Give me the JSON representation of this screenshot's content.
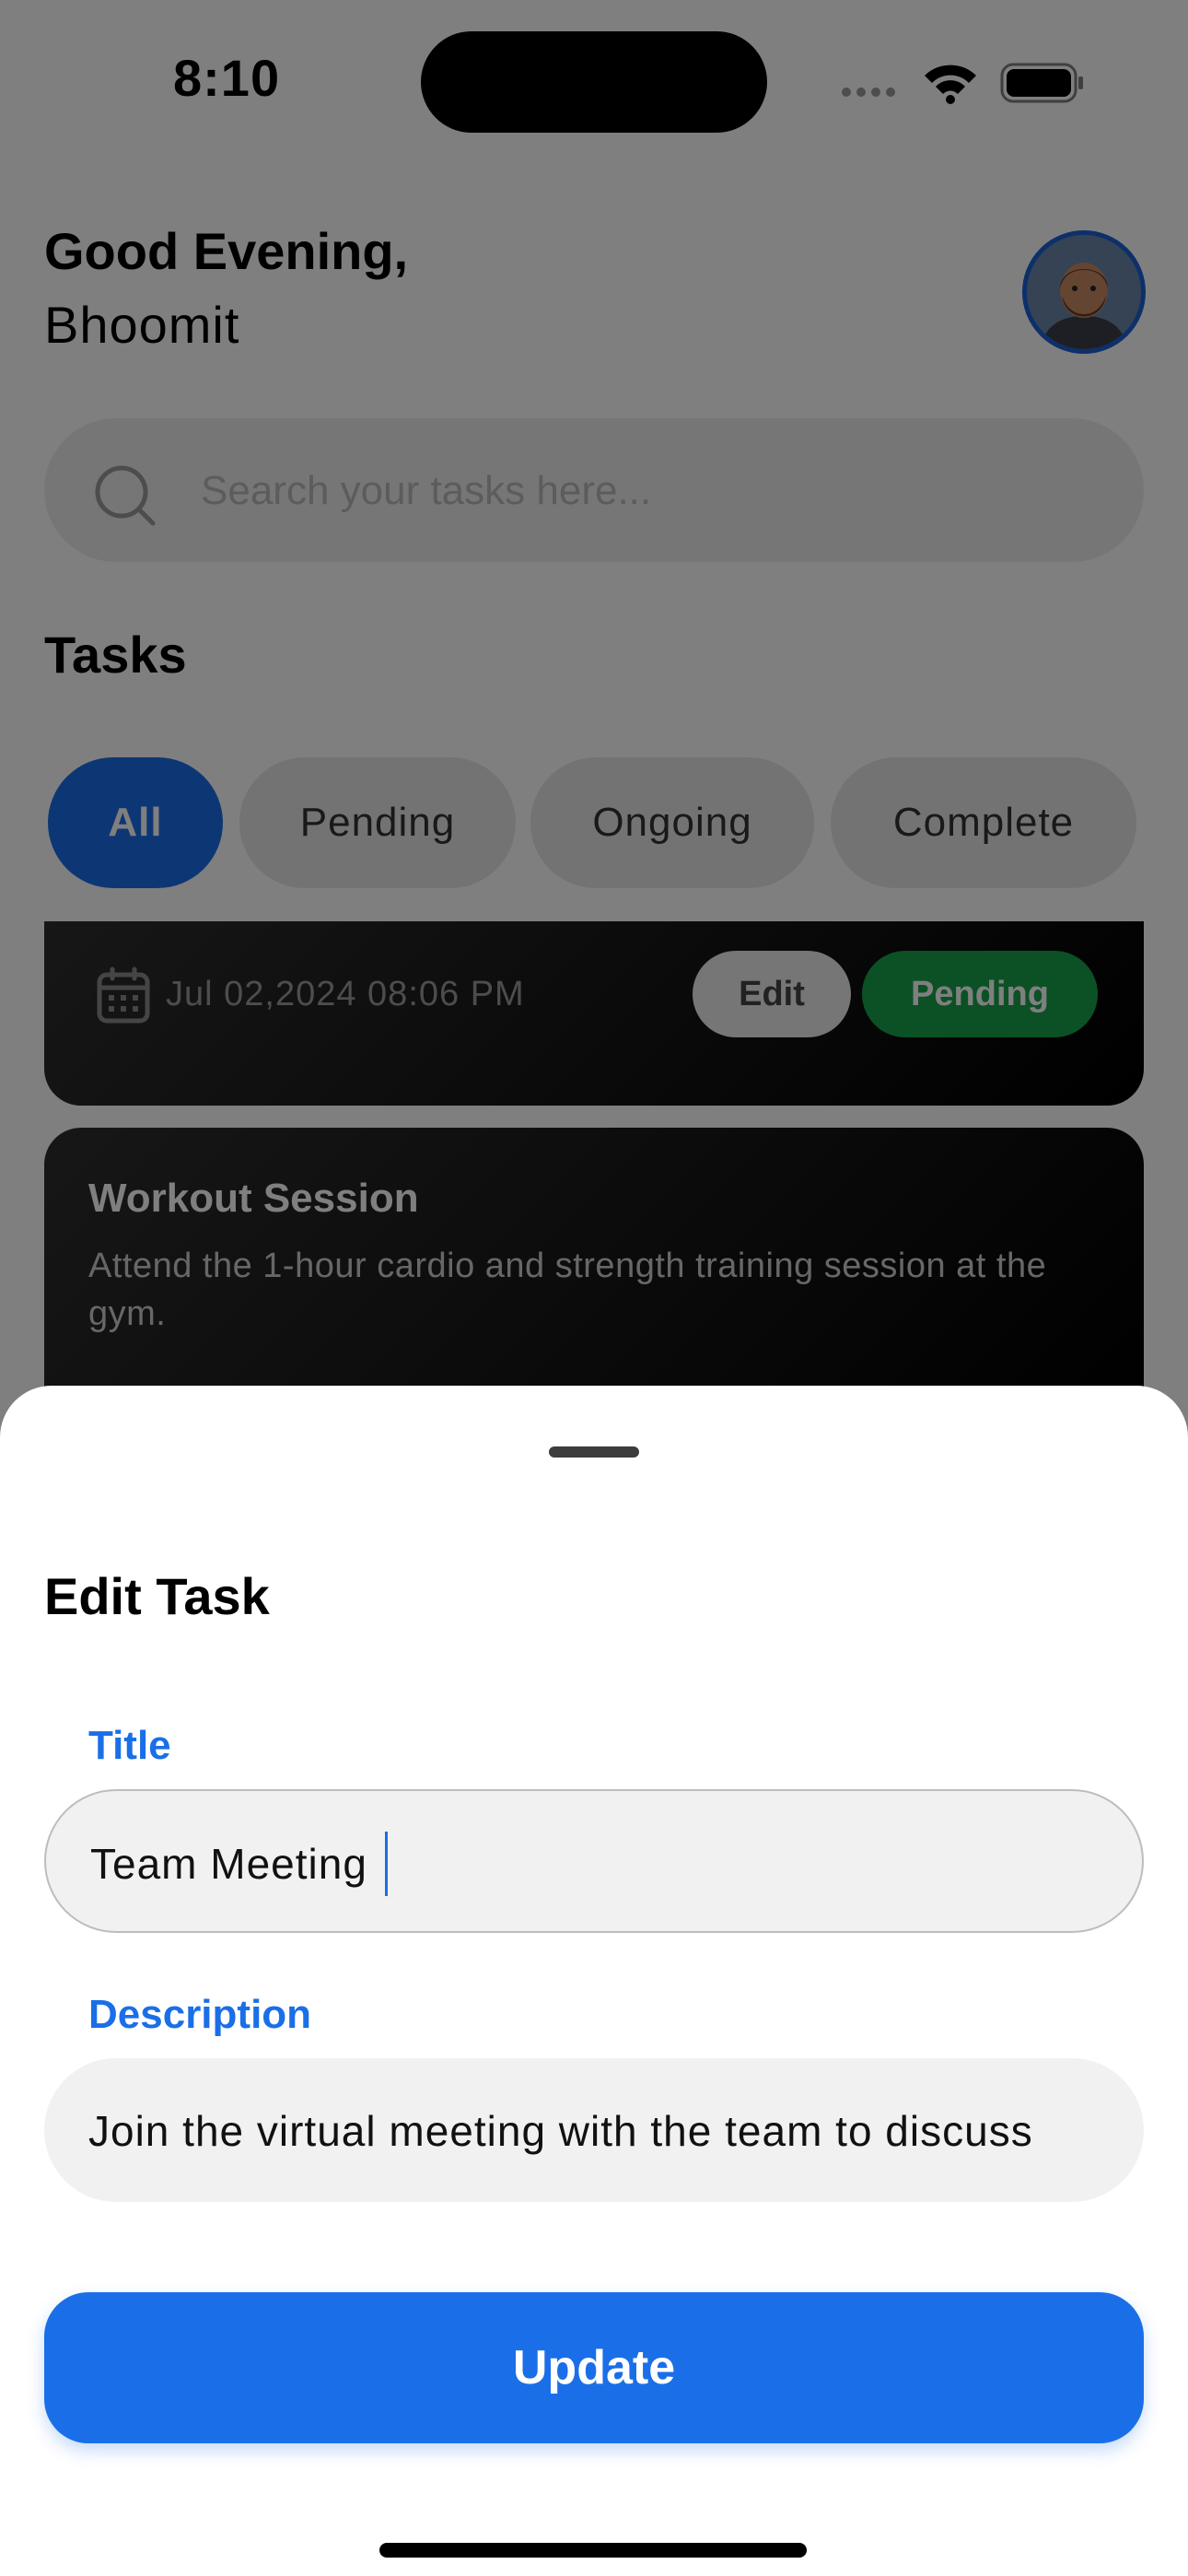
{
  "status_bar": {
    "time": "8:10"
  },
  "header": {
    "greeting": "Good Evening,",
    "user_name": "Bhoomit"
  },
  "search": {
    "placeholder": "Search your tasks here..."
  },
  "tasks_section": {
    "title": "Tasks",
    "filters": [
      {
        "label": "All",
        "active": true
      },
      {
        "label": "Pending",
        "active": false
      },
      {
        "label": "Ongoing",
        "active": false
      },
      {
        "label": "Complete",
        "active": false
      }
    ]
  },
  "task_cards": [
    {
      "date": "Jul 02,2024 08:06 PM",
      "edit_label": "Edit",
      "status_label": "Pending"
    },
    {
      "title": "Workout Session",
      "description": "Attend the 1-hour cardio and strength training session at the gym."
    }
  ],
  "sheet": {
    "title": "Edit Task",
    "title_label": "Title",
    "title_value": "Team Meeting",
    "description_label": "Description",
    "description_value": "Join the virtual meeting with the team to discuss",
    "update_label": "Update"
  },
  "colors": {
    "accent": "#1a6fe8",
    "pending_status": "#16a34a",
    "avatar_ring": "#1b61d6"
  }
}
